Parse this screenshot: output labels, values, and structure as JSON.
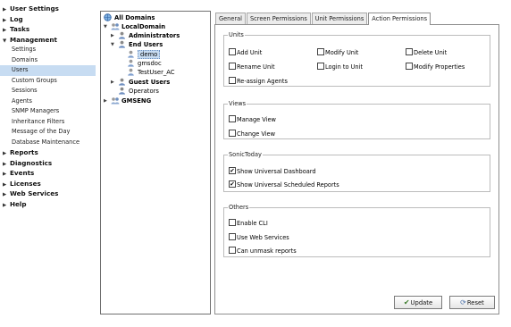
{
  "nav": {
    "sections": [
      {
        "label": "User Settings",
        "expanded": false,
        "items": []
      },
      {
        "label": "Log",
        "expanded": false,
        "items": []
      },
      {
        "label": "Tasks",
        "expanded": false,
        "items": []
      },
      {
        "label": "Management",
        "expanded": true,
        "items": [
          {
            "label": "Settings"
          },
          {
            "label": "Domains"
          },
          {
            "label": "Users",
            "selected": true
          },
          {
            "label": "Custom Groups"
          },
          {
            "label": "Sessions"
          },
          {
            "label": "Agents"
          },
          {
            "label": "SNMP Managers"
          },
          {
            "label": "Inheritance Filters"
          },
          {
            "label": "Message of the Day"
          },
          {
            "label": "Database Maintenance"
          }
        ]
      },
      {
        "label": "Reports",
        "expanded": false,
        "items": []
      },
      {
        "label": "Diagnostics",
        "expanded": false,
        "items": []
      },
      {
        "label": "Events",
        "expanded": false,
        "items": []
      },
      {
        "label": "Licenses",
        "expanded": false,
        "items": []
      },
      {
        "label": "Web Services",
        "expanded": false,
        "items": []
      },
      {
        "label": "Help",
        "expanded": false,
        "items": []
      }
    ]
  },
  "tree": {
    "nodes": [
      {
        "label": "All Domains",
        "level": 0,
        "bold": true,
        "icon": "globe-icon",
        "expander": ""
      },
      {
        "label": "LocalDomain",
        "level": 1,
        "bold": true,
        "icon": "domain-icon",
        "expander": "minus"
      },
      {
        "label": "Administrators",
        "level": 2,
        "bold": true,
        "icon": "users-group-icon",
        "expander": "plus"
      },
      {
        "label": "End Users",
        "level": 2,
        "bold": true,
        "icon": "users-group-icon",
        "expander": "minus"
      },
      {
        "label": "demo",
        "level": 3,
        "bold": false,
        "icon": "user-icon",
        "expander": "",
        "selected": true
      },
      {
        "label": "gmsdoc",
        "level": 3,
        "bold": false,
        "icon": "user-icon",
        "expander": ""
      },
      {
        "label": "TestUser_AC",
        "level": 3,
        "bold": false,
        "icon": "user-icon",
        "expander": ""
      },
      {
        "label": "Guest Users",
        "level": 2,
        "bold": true,
        "icon": "users-group-icon",
        "expander": "plus"
      },
      {
        "label": "Operators",
        "level": 2,
        "bold": false,
        "icon": "users-group-icon",
        "expander": ""
      },
      {
        "label": "GMSENG",
        "level": 1,
        "bold": true,
        "icon": "domain-icon",
        "expander": "plus"
      }
    ]
  },
  "tabs": [
    {
      "label": "General",
      "active": false
    },
    {
      "label": "Screen Permissions",
      "active": false
    },
    {
      "label": "Unit Permissions",
      "active": false
    },
    {
      "label": "Action Permissions",
      "active": true
    }
  ],
  "groups": [
    {
      "title": "Units",
      "items": [
        {
          "label": "Add Unit",
          "checked": false
        },
        {
          "label": "Modify Unit",
          "checked": false
        },
        {
          "label": "Delete Unit",
          "checked": false
        },
        {
          "label": "Rename Unit",
          "checked": false
        },
        {
          "label": "Login to Unit",
          "checked": false
        },
        {
          "label": "Modify Properties",
          "checked": false
        },
        {
          "label": "Re-assign Agents",
          "checked": false
        }
      ]
    },
    {
      "title": "Views",
      "items": [
        {
          "label": "Manage View",
          "checked": false
        },
        {
          "label": "Change View",
          "checked": false
        }
      ]
    },
    {
      "title": "SonicToday",
      "items": [
        {
          "label": "Show Universal Dashboard",
          "checked": true
        },
        {
          "label": "Show Universal Scheduled Reports",
          "checked": true
        }
      ]
    },
    {
      "title": "Others",
      "items": [
        {
          "label": "Enable CLI",
          "checked": false
        },
        {
          "label": "Use Web Services",
          "checked": false
        },
        {
          "label": "Can unmask reports",
          "checked": false
        }
      ]
    }
  ],
  "buttons": {
    "update": "Update",
    "reset": "Reset"
  }
}
